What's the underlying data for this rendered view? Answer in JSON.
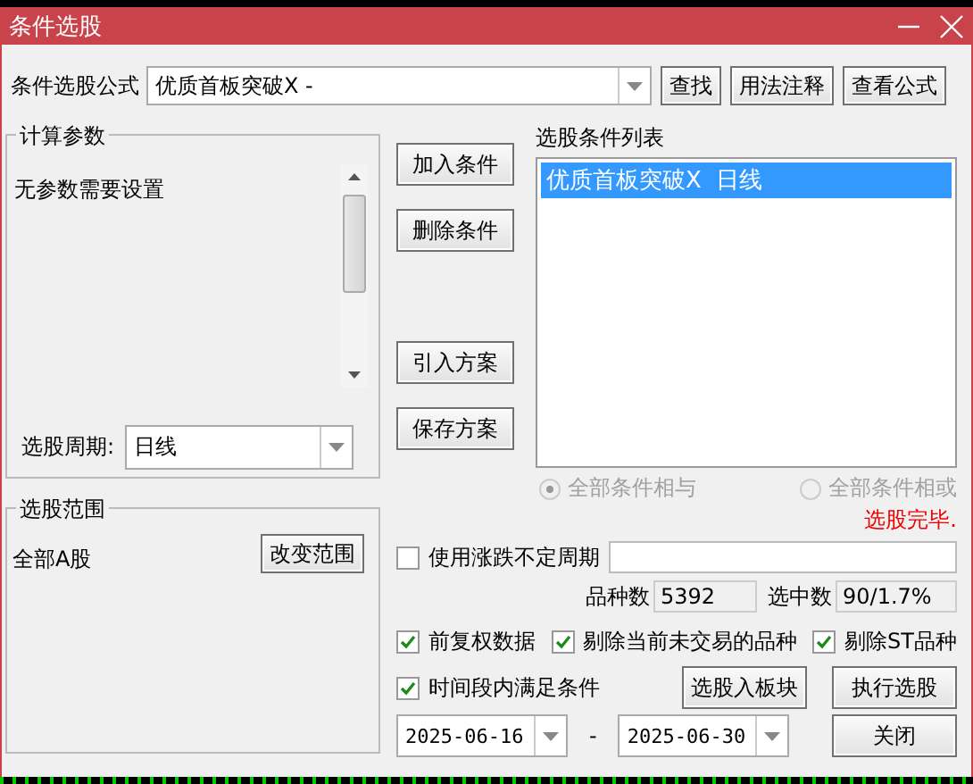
{
  "window": {
    "title": "条件选股"
  },
  "formula": {
    "label": "条件选股公式",
    "value": "优质首板突破X -",
    "buttons": [
      "查找",
      "用法注释",
      "查看公式"
    ]
  },
  "params": {
    "title": "计算参数",
    "message": "无参数需要设置",
    "period_label": "选股周期:",
    "period_value": "日线"
  },
  "actions": [
    "加入条件",
    "删除条件",
    "引入方案",
    "保存方案"
  ],
  "condition_list": {
    "title": "选股条件列表",
    "items": [
      {
        "label": "优质首板突破X  日线",
        "selected": true
      }
    ]
  },
  "logic": [
    {
      "label": "全部条件相与",
      "selected": true,
      "disabled": true
    },
    {
      "label": "全部条件相或",
      "selected": false,
      "disabled": true
    }
  ],
  "scope": {
    "title": "选股范围",
    "value": "全部A股",
    "button": "改变范围"
  },
  "status": "选股完毕.",
  "variable_period": {
    "label": "使用涨跌不定周期",
    "checked": false
  },
  "stats": [
    {
      "label": "品种数",
      "value": "5392"
    },
    {
      "label": "选中数",
      "value": "90/1.7%"
    }
  ],
  "options": [
    {
      "label": "前复权数据",
      "checked": true
    },
    {
      "label": "剔除当前未交易的品种",
      "checked": true
    },
    {
      "label": "剔除ST品种",
      "checked": true
    }
  ],
  "time_range": {
    "label": "时间段内满足条件",
    "checked": true,
    "start": "2025-06-16",
    "separator": "-",
    "end": "2025-06-30"
  },
  "buttons": [
    "选股入板块",
    "执行选股",
    "关闭"
  ]
}
